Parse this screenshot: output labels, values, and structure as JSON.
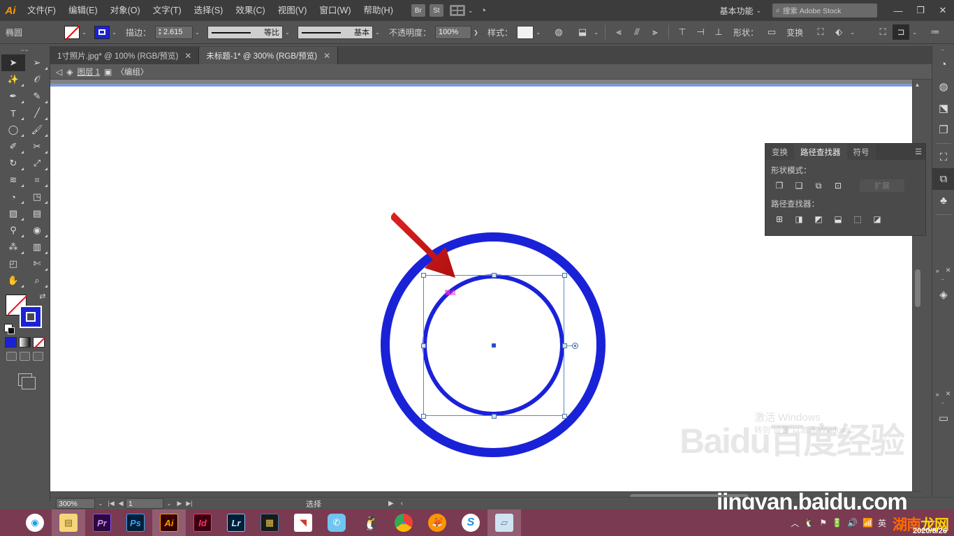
{
  "app": {
    "name": "Adobe Illustrator",
    "logo_text": "Ai"
  },
  "menubar": {
    "items": [
      {
        "label": "文件(F)"
      },
      {
        "label": "编辑(E)"
      },
      {
        "label": "对象(O)"
      },
      {
        "label": "文字(T)"
      },
      {
        "label": "选择(S)"
      },
      {
        "label": "效果(C)"
      },
      {
        "label": "视图(V)"
      },
      {
        "label": "窗口(W)"
      },
      {
        "label": "帮助(H)"
      }
    ],
    "bridge_label": "Br",
    "stock_label": "St",
    "arrange_icon": "arrange-documents-icon",
    "cloud_icon": "cloud-sync-icon",
    "workspace": "基本功能",
    "search_placeholder": "搜索 Adobe Stock",
    "search_icon": "search-icon",
    "window_controls": {
      "minimize": "—",
      "maximize": "❐",
      "close": "✕"
    }
  },
  "optionsbar": {
    "object_type": "椭圆",
    "fill_swatch": "none-fill-swatch",
    "stroke_swatch": "blue-stroke-swatch",
    "stroke_label": "描边：",
    "stroke_weight": "2.615 ",
    "stroke_profile": "等比",
    "brush_definition": "基本",
    "opacity_label": "不透明度：",
    "opacity_value": "100%",
    "style_label": "样式：",
    "shape_label": "形状：",
    "transform_label": "变换",
    "icons": [
      "opacity-knockout-icon",
      "isolate-icon",
      "align-left-icon",
      "align-center-h-icon",
      "align-right-icon",
      "align-top-icon",
      "align-middle-v-icon",
      "align-bottom-icon",
      "distribute-top-icon",
      "distribute-center-icon",
      "distribute-bottom-icon",
      "shape-options-icon",
      "transform-icon",
      "envelope-distort-icon",
      "arrange-icon",
      "select-similar-icon",
      "document-setup-icon",
      "preferences-icon"
    ]
  },
  "tabs": [
    {
      "label": "1寸照片.jpg* @ 100% (RGB/预览)",
      "active": false,
      "close": "✕"
    },
    {
      "label": "未标题-1* @ 300% (RGB/预览)",
      "active": true,
      "close": "✕"
    }
  ],
  "breadcrumb": {
    "back_icon": "back-arrow-icon",
    "layers_icon": "layers-icon",
    "layer_name": "图层 1",
    "group_icon": "group-icon",
    "group_label": "〈编组〉"
  },
  "toolbar": {
    "tools": [
      {
        "name": "selection-tool",
        "glyph": "➤",
        "selected": true
      },
      {
        "name": "direct-selection-tool",
        "glyph": "➢",
        "selected": false
      },
      {
        "name": "magic-wand-tool",
        "glyph": "✨",
        "selected": false
      },
      {
        "name": "lasso-tool",
        "glyph": "ᘓ",
        "selected": false
      },
      {
        "name": "pen-tool",
        "glyph": "✎",
        "selected": false
      },
      {
        "name": "curvature-tool",
        "glyph": "✒",
        "selected": false
      },
      {
        "name": "type-tool",
        "glyph": "T",
        "selected": false
      },
      {
        "name": "line-segment-tool",
        "glyph": "╱",
        "selected": false
      },
      {
        "name": "ellipse-tool",
        "glyph": "◯",
        "selected": false
      },
      {
        "name": "paintbrush-tool",
        "glyph": "🖌",
        "selected": false
      },
      {
        "name": "shaper-tool",
        "glyph": "✐",
        "selected": false
      },
      {
        "name": "scissors-tool",
        "glyph": "✂",
        "selected": false
      },
      {
        "name": "rotate-tool",
        "glyph": "↻",
        "selected": false
      },
      {
        "name": "scale-tool",
        "glyph": "⤢",
        "selected": false
      },
      {
        "name": "width-tool",
        "glyph": "≋",
        "selected": false
      },
      {
        "name": "free-transform-tool",
        "glyph": "⊞",
        "selected": false
      },
      {
        "name": "shape-builder-tool",
        "glyph": "◔",
        "selected": false
      },
      {
        "name": "perspective-grid-tool",
        "glyph": "◳",
        "selected": false
      },
      {
        "name": "mesh-tool",
        "glyph": "▨",
        "selected": false
      },
      {
        "name": "gradient-tool",
        "glyph": "▤",
        "selected": false
      },
      {
        "name": "eyedropper-tool",
        "glyph": "⚲",
        "selected": false
      },
      {
        "name": "blend-tool",
        "glyph": "◉",
        "selected": false
      },
      {
        "name": "symbol-sprayer-tool",
        "glyph": "⁂",
        "selected": false
      },
      {
        "name": "column-graph-tool",
        "glyph": "▥",
        "selected": false
      },
      {
        "name": "artboard-tool",
        "glyph": "◰",
        "selected": false
      },
      {
        "name": "slice-tool",
        "glyph": "✂",
        "selected": false
      },
      {
        "name": "hand-tool",
        "glyph": "✋",
        "selected": false
      },
      {
        "name": "zoom-tool",
        "glyph": "⌕",
        "selected": false
      }
    ],
    "fill_state": "none",
    "stroke_color": "#1a22d8",
    "swap_icon": "swap-fill-stroke-icon",
    "default_icon": "default-fill-stroke-icon",
    "color_modes": [
      "color-swatch",
      "gradient-swatch",
      "none-swatch"
    ],
    "screen_modes": [
      "normal-screen-mode",
      "full-screen-menu-mode",
      "full-screen-mode"
    ],
    "edit_toolbar_icon": "edit-toolbar-icon"
  },
  "canvas": {
    "zoom": "300%",
    "artwork": {
      "outer_ring_color": "#1a22d8",
      "inner_ring_color": "#1a22d8",
      "selection_color": "#5b84c9",
      "smart_guide_label": "锚点",
      "annotation_arrow_color": "#d81a1a"
    }
  },
  "pathfinder": {
    "tabs": [
      {
        "label": "变换",
        "active": false
      },
      {
        "label": "路径查找器",
        "active": true
      },
      {
        "label": "符号",
        "active": false
      }
    ],
    "collapse_icon": "double-chevron-icon",
    "menu_icon": "panel-menu-icon",
    "shape_modes_label": "形状模式：",
    "shape_modes": [
      {
        "name": "unite-button",
        "glyph": "❐"
      },
      {
        "name": "minus-front-button",
        "glyph": "❏"
      },
      {
        "name": "intersect-button",
        "glyph": "⧉"
      },
      {
        "name": "exclude-button",
        "glyph": "⊡"
      }
    ],
    "expand_label": "扩展",
    "pathfinders_label": "路径查找器：",
    "pathfinders": [
      {
        "name": "divide-button",
        "glyph": "⊞"
      },
      {
        "name": "trim-button",
        "glyph": "◨"
      },
      {
        "name": "merge-button",
        "glyph": "◩"
      },
      {
        "name": "crop-button",
        "glyph": "⬓"
      },
      {
        "name": "outline-button",
        "glyph": "⬚"
      },
      {
        "name": "minus-back-button",
        "glyph": "◪"
      }
    ]
  },
  "right_dock": {
    "icons": [
      {
        "name": "color-panel-icon",
        "glyph": "◔",
        "active": false
      },
      {
        "name": "color-guide-panel-icon",
        "glyph": "◍",
        "active": false
      },
      {
        "name": "libraries-panel-icon",
        "glyph": "⬔",
        "active": false
      },
      {
        "name": "asset-export-panel-icon",
        "glyph": "❐",
        "active": false
      },
      {
        "name": "transform-panel-icon",
        "glyph": "⛶",
        "active": false
      },
      {
        "name": "pathfinder-panel-icon",
        "glyph": "⧉",
        "active": true
      },
      {
        "name": "symbols-panel-icon",
        "glyph": "♣",
        "active": false
      },
      {
        "name": "layers-panel-icon",
        "glyph": "◈",
        "active": false
      },
      {
        "name": "gradient-panel-icon",
        "glyph": "▭",
        "active": false
      }
    ],
    "collapse_glyph": "»",
    "close_glyph": "✕"
  },
  "statusbar": {
    "zoom": "300%",
    "first_glyph": "|◀",
    "prev_glyph": "◀",
    "page": "1",
    "next_glyph": "▶",
    "last_glyph": "▶|",
    "tool_status": "选择",
    "play_glyph": "▶",
    "more_glyph": "‹"
  },
  "taskbar": {
    "apps": [
      {
        "name": "taskbar-360-browser",
        "label": "",
        "bg": "#ffffff",
        "color": "#1a9de0",
        "open": false
      },
      {
        "name": "taskbar-file-explorer",
        "label": "",
        "bg": "#f5d77a",
        "color": "#8a6a20",
        "open": true
      },
      {
        "name": "taskbar-premiere-pro",
        "label": "Pr",
        "bg": "#2a0a3c",
        "color": "#d18bff",
        "open": false
      },
      {
        "name": "taskbar-photoshop",
        "label": "Ps",
        "bg": "#001e36",
        "color": "#31a8ff",
        "open": false
      },
      {
        "name": "taskbar-illustrator",
        "label": "Ai",
        "bg": "#330000",
        "color": "#ff9a00",
        "open": true
      },
      {
        "name": "taskbar-indesign",
        "label": "Id",
        "bg": "#3b0010",
        "color": "#ff3366",
        "open": false
      },
      {
        "name": "taskbar-lightroom",
        "label": "Lr",
        "bg": "#001e36",
        "color": "#c8e6ff",
        "open": false
      },
      {
        "name": "taskbar-media-encoder",
        "label": "",
        "bg": "#1a1a1a",
        "color": "#e8c84a",
        "open": false
      },
      {
        "name": "taskbar-wps-office",
        "label": "",
        "bg": "#ffffff",
        "color": "#d7342c",
        "open": false
      },
      {
        "name": "taskbar-wechat",
        "label": "",
        "bg": "#6fc4f0",
        "color": "#ffffff",
        "open": false
      },
      {
        "name": "taskbar-qq",
        "label": "",
        "bg": "#ffffff",
        "color": "#222222",
        "open": false
      },
      {
        "name": "taskbar-chrome",
        "label": "",
        "bg": "#ffffff",
        "color": "#4285f4",
        "open": false
      },
      {
        "name": "taskbar-firefox",
        "label": "",
        "bg": "#ff9500",
        "color": "#ffffff",
        "open": false
      },
      {
        "name": "taskbar-sogou",
        "label": "",
        "bg": "#ffffff",
        "color": "#1f8ce0",
        "open": false
      },
      {
        "name": "taskbar-picture-viewer",
        "label": "",
        "bg": "#cfe3f0",
        "color": "#4a7fa8",
        "open": true
      }
    ],
    "tray_icons": [
      "show-hidden-icons",
      "qq-tray-icon",
      "network-tray-icon",
      "battery-icon",
      "volume-icon",
      "signal-icon"
    ],
    "ime_label": "英",
    "date": "2020/8/26",
    "watermark": {
      "part1": "湖南",
      "part2": "龙网"
    }
  },
  "watermarks": {
    "activate_line1": "激活 Windows",
    "activate_line2": "转到\"设置\"以激活 Windows。",
    "jingyan": "jingyan.baidu.com",
    "baidu_logo": "Baidu百度经验"
  }
}
